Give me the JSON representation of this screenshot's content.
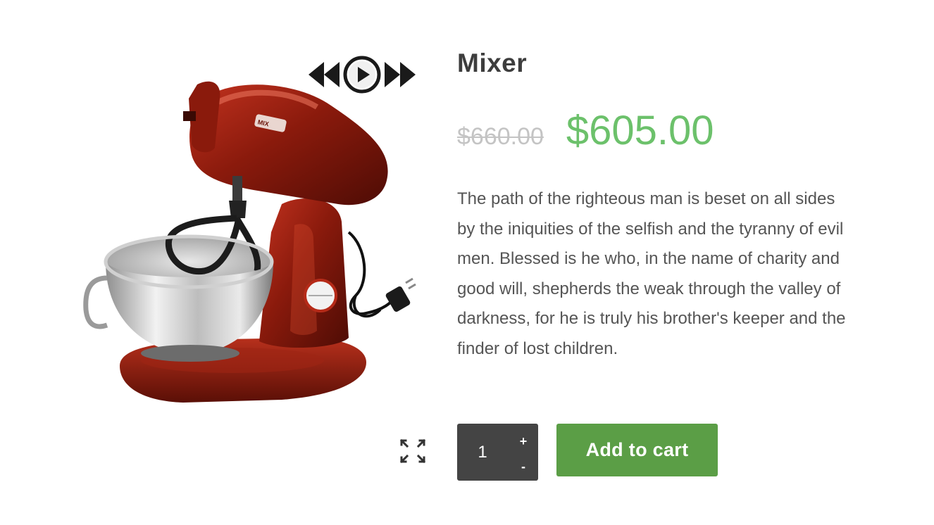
{
  "gallery": {
    "prev_icon": "rewind-icon",
    "play_icon": "play-icon",
    "next_icon": "fast-forward-icon"
  },
  "product": {
    "title": "Mixer",
    "price_old": "$660.00",
    "price_new": "$605.00",
    "description": "The path of the righteous man is beset on all sides by the iniquities of the selfish and the tyranny of evil men. Blessed is he who, in the name of charity and good will, shepherds the weak through the valley of darkness, for he is truly his brother's keeper and the finder of lost children.",
    "image_label": "MIXER",
    "image_icon": "stand-mixer-image"
  },
  "cart": {
    "quantity": "1",
    "plus_label": "+",
    "minus_label": "-",
    "add_label": "Add to cart"
  },
  "colors": {
    "price_new": "#6cc16b",
    "price_old": "#c4c4c4",
    "button": "#5b9e46",
    "qty_bg": "#444444",
    "text": "#555555"
  }
}
